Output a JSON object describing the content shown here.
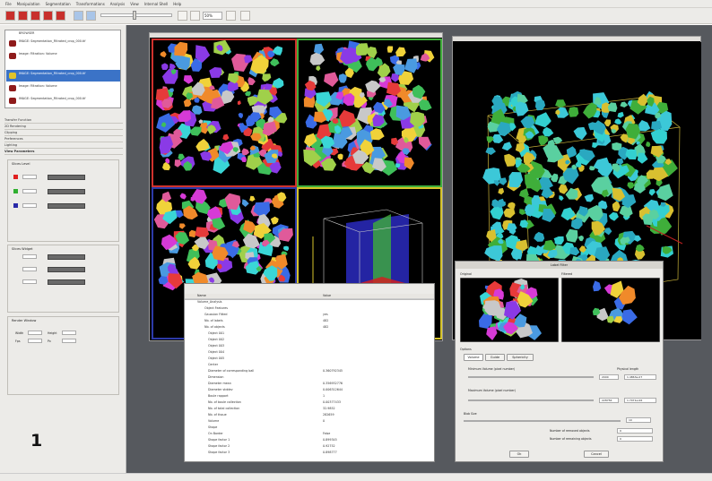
{
  "menu": [
    "File",
    "Manipulation",
    "Segmentation",
    "Transformations",
    "Analysis",
    "View",
    "Internal Shell",
    "Help"
  ],
  "toolbar": {
    "zoom_value": "50%"
  },
  "objects": [
    {
      "label": "BROWSER"
    },
    {
      "label": "IMAGE: Segmentation_Filtrated_crop_000.tif"
    },
    {
      "label": "Image: Filtration: Volume"
    },
    {
      "label": "IMAGE: Segmentation_Filtrated_crop_000.tif"
    },
    {
      "label": "Image: Filtration: Volume"
    },
    {
      "label": "IMAGE: Segmentation_Filtrated_crop_000.tif"
    }
  ],
  "sections": [
    "Transfer Function",
    "2D Rendering",
    "Clipping",
    "Preferences",
    "Lighting",
    "View Parameters"
  ],
  "groups": {
    "slice_level": "Slices Level",
    "slices_widget": "Slices Widget",
    "render_window": "Render Window",
    "width": "Width",
    "height": "Height",
    "fps": "Fps",
    "px": "Px"
  },
  "info": {
    "col_name": "Name",
    "col_value": "Value",
    "rows": [
      {
        "n": "Volume_Analysis",
        "v": ""
      },
      {
        "n": "Object Features",
        "v": ""
      },
      {
        "n": "Gaussian Fitted",
        "v": "yes"
      },
      {
        "n": "Nb. of labels",
        "v": "482"
      },
      {
        "n": "Nb. of objects",
        "v": "482"
      },
      {
        "n": "Object 001",
        "v": ""
      },
      {
        "n": "Object 002",
        "v": ""
      },
      {
        "n": "Object 003",
        "v": ""
      },
      {
        "n": "Object 004",
        "v": ""
      },
      {
        "n": "Object 005",
        "v": ""
      },
      {
        "n": "Center",
        "v": ""
      },
      {
        "n": "Diameter of corresponding ball",
        "v": "0.360792345"
      },
      {
        "n": "Dimension",
        "v": ""
      },
      {
        "n": "Diameter mean",
        "v": "0.356932776"
      },
      {
        "n": "Diameter stddev",
        "v": "0.006312644"
      },
      {
        "n": "Boule rapport",
        "v": "1"
      },
      {
        "n": "Nb. of boule collection",
        "v": "0.00377433"
      },
      {
        "n": "Nb. of total collection",
        "v": "32.9852"
      },
      {
        "n": "Nb. of tissue",
        "v": "282659"
      },
      {
        "n": "Volume",
        "v": "0"
      },
      {
        "n": "Shape",
        "v": ""
      },
      {
        "n": "On Border",
        "v": "False"
      },
      {
        "n": "Shape factor 1",
        "v": "0.899345"
      },
      {
        "n": "Shape factor 2",
        "v": "0.92752"
      },
      {
        "n": "Shape factor 3",
        "v": "0.898777"
      }
    ]
  },
  "dialog": {
    "title": "Label Filter",
    "original": "Original",
    "filtered": "Filtered",
    "options": "Options",
    "tabs": [
      "Volume",
      "Guide",
      "Sphericity"
    ],
    "min_label": "Minimum Volume (pixel number)",
    "max_label": "Maximum Volume (pixel number)",
    "phys_label": "Physical length",
    "min_px": "2000",
    "min_phys": "1.4863e-07",
    "max_px": "228756",
    "max_phys": "1.7071e-06",
    "blob_label": "Blob Size",
    "blob_val": "10",
    "removed_label": "Number of removed objects",
    "removed_val": "0",
    "remaining_label": "Number of remaining objects",
    "remaining_val": "0",
    "ok": "Ok",
    "cancel": "Cancel"
  },
  "figure_number": "1",
  "colors": {
    "red_frame": "#d0322d",
    "green_frame": "#3fae3a",
    "yellow_frame": "#d6c42a",
    "blue_frame": "#2c3aa8",
    "selected": "#3b73c7"
  }
}
